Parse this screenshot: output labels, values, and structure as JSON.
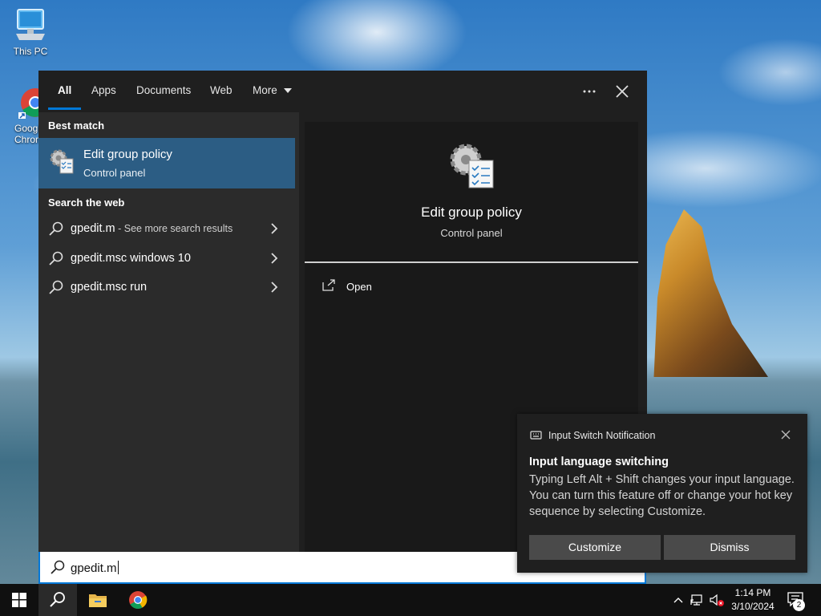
{
  "desktop": {
    "icons": [
      {
        "label": "This PC"
      },
      {
        "label": "Google Chrome"
      }
    ]
  },
  "search": {
    "tabs": [
      {
        "label": "All",
        "active": true
      },
      {
        "label": "Apps"
      },
      {
        "label": "Documents"
      },
      {
        "label": "Web"
      },
      {
        "label": "More"
      }
    ],
    "best_match_title": "Best match",
    "best_match": {
      "name": "Edit group policy",
      "type": "Control panel"
    },
    "web_title": "Search the web",
    "web_results": [
      {
        "query": "gpedit.m",
        "suffix": " - See more search results"
      },
      {
        "query": "gpedit.msc windows 10",
        "suffix": ""
      },
      {
        "query": "gpedit.msc run",
        "suffix": ""
      }
    ],
    "detail": {
      "name": "Edit group policy",
      "type": "Control panel",
      "action": "Open"
    },
    "query": "gpedit.m"
  },
  "notification": {
    "app": "Input Switch Notification",
    "heading": "Input language switching",
    "body": "Typing Left Alt + Shift changes your input language. You can turn this feature off or change your hot key sequence by selecting Customize.",
    "customize": "Customize",
    "dismiss": "Dismiss"
  },
  "taskbar": {
    "time": "1:14 PM",
    "date": "3/10/2024",
    "notification_count": "2"
  },
  "colors": {
    "accent": "#0078d7",
    "selected": "#2c5d84"
  }
}
